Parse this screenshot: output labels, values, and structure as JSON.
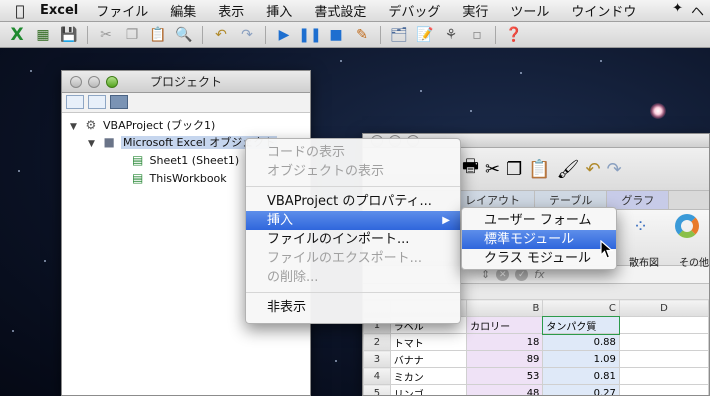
{
  "menubar": {
    "app": "Excel",
    "items": [
      "ファイル",
      "編集",
      "表示",
      "挿入",
      "書式設定",
      "デバッグ",
      "実行",
      "ツール",
      "ウインドウ"
    ],
    "tail": "ヘ"
  },
  "project_window": {
    "title": "プロジェクト",
    "tree": {
      "root": "VBAProject (ブック1)",
      "folder": "Microsoft Excel オブジェクト",
      "items": [
        "Sheet1 (Sheet1)",
        "ThisWorkbook"
      ]
    }
  },
  "context_menu": {
    "items": [
      {
        "label": "コードの表示",
        "enabled": false
      },
      {
        "label": "オブジェクトの表示",
        "enabled": false
      },
      {
        "label": "VBAProject のプロパティ...",
        "enabled": true
      },
      {
        "label": "挿入",
        "enabled": true,
        "selected": true,
        "submenu": true
      },
      {
        "label": "ファイルのインポート...",
        "enabled": true
      },
      {
        "label": "ファイルのエクスポート...",
        "enabled": false
      },
      {
        "label": "の削除...",
        "enabled": false
      },
      {
        "label": "非表示",
        "enabled": true
      }
    ]
  },
  "submenu": {
    "items": [
      {
        "label": "ユーザー フォーム",
        "selected": false
      },
      {
        "label": "標準モジュール",
        "selected": true
      },
      {
        "label": "クラス モジュール",
        "selected": false
      }
    ]
  },
  "excel": {
    "ribbon_tabs": [
      "レイアウト",
      "テーブル",
      "グラフ"
    ],
    "ribbon_labels": {
      "scatter": "散布図",
      "other": "その他"
    },
    "formula_bar": {
      "fx": "fx"
    },
    "columns": [
      "B",
      "C",
      "D"
    ],
    "header_row": {
      "row": "1",
      "a": "ラベル",
      "b": "カロリー",
      "c": "タンパク質"
    },
    "rows": [
      {
        "row": "2",
        "a": "トマト",
        "b": "18",
        "c": "0.88"
      },
      {
        "row": "3",
        "a": "バナナ",
        "b": "89",
        "c": "1.09"
      },
      {
        "row": "4",
        "a": "ミカン",
        "b": "53",
        "c": "0.81"
      },
      {
        "row": "5",
        "a": "リンゴ",
        "b": "48",
        "c": "0.27"
      }
    ]
  },
  "colors": {
    "menu_highlight": "#2f66dc",
    "column_b_fill": "#efe2f6",
    "column_c_fill": "#dfe9f8"
  }
}
